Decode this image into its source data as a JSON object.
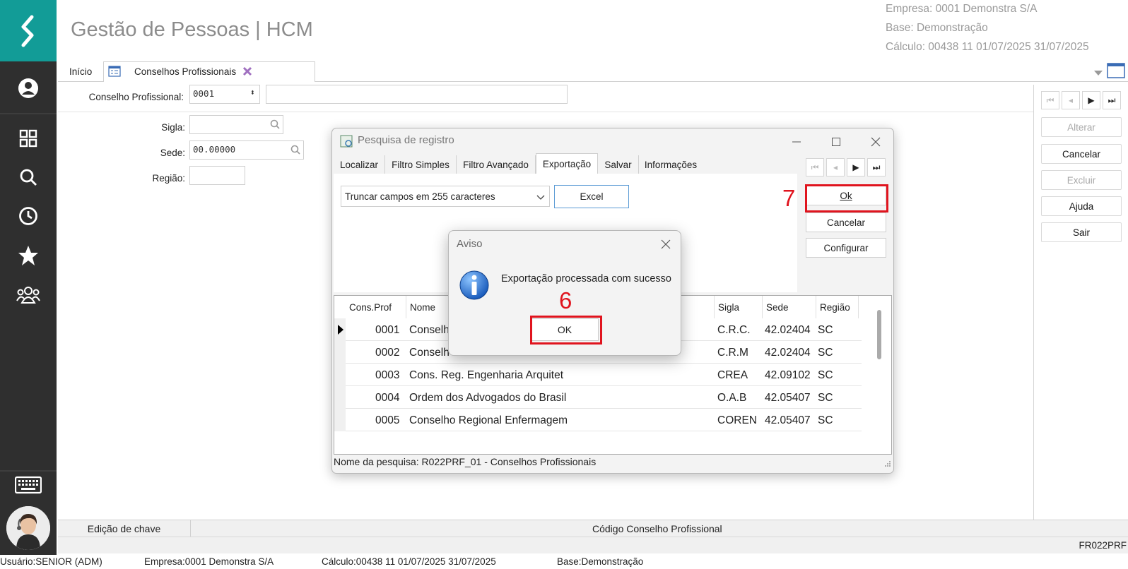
{
  "header": {
    "title": "Gestão de Pessoas | HCM",
    "empresa": "Empresa: 0001  Demonstra S/A",
    "base": "Base: Demonstração",
    "calculo": "Cálculo: 00438  11  01/07/2025  31/07/2025"
  },
  "sidebar": {
    "icons": [
      "profile-icon",
      "grid-icon",
      "search-icon",
      "clock-icon",
      "star-icon",
      "team-icon",
      "keyboard-icon",
      "assistant-avatar"
    ]
  },
  "tabs": {
    "inicio": "Início",
    "conselhos": "Conselhos Profissionais"
  },
  "form": {
    "conselho_label": "Conselho Profissional:",
    "conselho_value": "0001",
    "sigla_label": "Sigla:",
    "sede_label": "Sede:",
    "sede_value": "00.00000",
    "regiao_label": "Região:"
  },
  "right_panel": {
    "alterar": "Alterar",
    "cancelar": "Cancelar",
    "excluir": "Excluir",
    "ajuda": "Ajuda",
    "sair": "Sair"
  },
  "search_dialog": {
    "title": "Pesquisa de registro",
    "tabs": [
      "Localizar",
      "Filtro Simples",
      "Filtro Avançado",
      "Exportação",
      "Salvar",
      "Informações"
    ],
    "active_tab": "Exportação",
    "export_select": "Truncar campos em 255 caracteres",
    "excel_button": "Excel",
    "ok_button": "Ok",
    "cancelar_button": "Cancelar",
    "configurar_button": "Configurar",
    "columns": [
      "Cons.Prof",
      "Nome",
      "Sigla",
      "Sede",
      "Região"
    ],
    "rows": [
      {
        "cod": "0001",
        "nome": "Conselh",
        "sigla": "C.R.C.",
        "sede": "42.02404",
        "regiao": "SC"
      },
      {
        "cod": "0002",
        "nome": "Conselh",
        "sigla": "C.R.M",
        "sede": "42.02404",
        "regiao": "SC"
      },
      {
        "cod": "0003",
        "nome": "Cons. Reg. Engenharia Arquitet",
        "sigla": "CREA",
        "sede": "42.09102",
        "regiao": "SC"
      },
      {
        "cod": "0004",
        "nome": "Ordem dos Advogados do Brasil",
        "sigla": "O.A.B",
        "sede": "42.05407",
        "regiao": "SC"
      },
      {
        "cod": "0005",
        "nome": "Conselho Regional Enfermagem",
        "sigla": "COREN",
        "sede": "42.05407",
        "regiao": "SC"
      }
    ],
    "status": "Nome da pesquisa: R022PRF_01 - Conselhos Profissionais"
  },
  "aviso": {
    "title": "Aviso",
    "message": "Exportação processada com sucesso",
    "ok": "OK"
  },
  "annotations": {
    "step6": "6",
    "step7": "7",
    "color": "#e0141e"
  },
  "bottom": {
    "edicao": "Edição de chave",
    "codigo": "Código Conselho Profissional",
    "form_code": "FR022PRF"
  },
  "user_bar": {
    "usuario": "Usuário:SENIOR (ADM)",
    "empresa": "Empresa:0001  Demonstra S/A",
    "calculo": "Cálculo:00438  11  01/07/2025  31/07/2025",
    "base": "Base:Demonstração"
  }
}
